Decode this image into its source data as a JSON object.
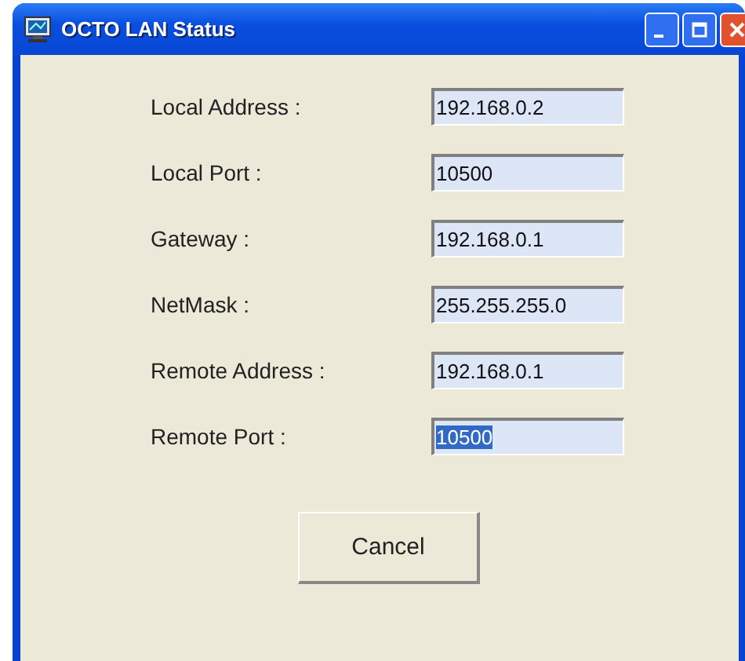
{
  "window": {
    "title": "OCTO LAN Status"
  },
  "fields": [
    {
      "label": "Local Address :",
      "value": "192.168.0.2",
      "selected": false
    },
    {
      "label": "Local Port :",
      "value": "10500",
      "selected": false
    },
    {
      "label": "Gateway :",
      "value": "192.168.0.1",
      "selected": false
    },
    {
      "label": "NetMask :",
      "value": "255.255.255.0",
      "selected": false
    },
    {
      "label": "Remote Address :",
      "value": "192.168.0.1",
      "selected": false
    },
    {
      "label": "Remote Port :",
      "value": "10500",
      "selected": true
    }
  ],
  "buttons": [
    "Cancel"
  ]
}
